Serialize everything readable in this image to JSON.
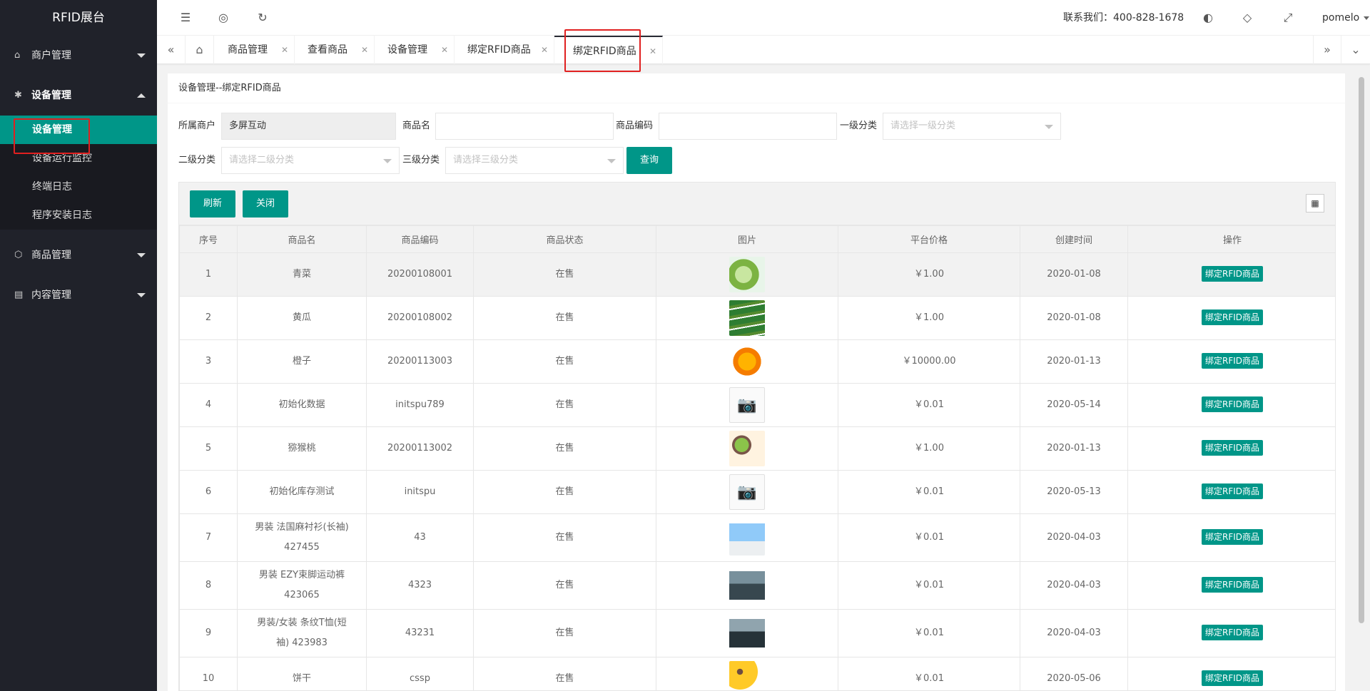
{
  "app": {
    "title": "RFID展台"
  },
  "sidebar": {
    "items": [
      {
        "label": "商户管理",
        "icon": "home-icon"
      },
      {
        "label": "设备管理",
        "icon": "gear-icon"
      },
      {
        "label": "商品管理",
        "icon": "box-icon"
      },
      {
        "label": "内容管理",
        "icon": "document-icon"
      }
    ],
    "device_sub": [
      "设备管理",
      "设备运行监控",
      "终端日志",
      "程序安装日志"
    ]
  },
  "header": {
    "contact": "联系我们：400-828-1678",
    "user": "pomelo"
  },
  "tabs": [
    {
      "label": "商品管理"
    },
    {
      "label": "查看商品"
    },
    {
      "label": "设备管理"
    },
    {
      "label": "绑定RFID商品"
    },
    {
      "label": "绑定RFID商品"
    }
  ],
  "card": {
    "title": "设备管理--绑定RFID商品"
  },
  "filters": {
    "merchant_label": "所属商户",
    "merchant_value": "多屏互动",
    "name_label": "商品名",
    "code_label": "商品编码",
    "cat1_label": "一级分类",
    "cat1_placeholder": "请选择一级分类",
    "cat2_label": "二级分类",
    "cat2_placeholder": "请选择二级分类",
    "cat3_label": "三级分类",
    "cat3_placeholder": "请选择三级分类",
    "query_label": "查询"
  },
  "toolbar": {
    "refresh_label": "刷新",
    "close_label": "关闭"
  },
  "table": {
    "headers": [
      "序号",
      "商品名",
      "商品编码",
      "商品状态",
      "图片",
      "平台价格",
      "创建时间",
      "操作"
    ],
    "action_label": "绑定RFID商品",
    "rows": [
      {
        "no": "1",
        "name": "青菜",
        "code": "20200108001",
        "status": "在售",
        "img": "bok-choy",
        "price": "￥1.00",
        "date": "2020-01-08"
      },
      {
        "no": "2",
        "name": "黄瓜",
        "code": "20200108002",
        "status": "在售",
        "img": "cucumber",
        "price": "￥1.00",
        "date": "2020-01-08"
      },
      {
        "no": "3",
        "name": "橙子",
        "code": "20200113003",
        "status": "在售",
        "img": "orange",
        "price": "￥10000.00",
        "date": "2020-01-13"
      },
      {
        "no": "4",
        "name": "初始化数据",
        "code": "initspu789",
        "status": "在售",
        "img": "placeholder",
        "price": "￥0.01",
        "date": "2020-05-14"
      },
      {
        "no": "5",
        "name": "猕猴桃",
        "code": "20200113002",
        "status": "在售",
        "img": "kiwi",
        "price": "￥1.00",
        "date": "2020-01-13"
      },
      {
        "no": "6",
        "name": "初始化库存测试",
        "code": "initspu",
        "status": "在售",
        "img": "placeholder",
        "price": "￥0.01",
        "date": "2020-05-13"
      },
      {
        "no": "7",
        "name1": "男装 法国麻衬衫(长袖)",
        "name2": "427455",
        "code": "43",
        "status": "在售",
        "img": "shirt",
        "price": "￥0.01",
        "date": "2020-04-03"
      },
      {
        "no": "8",
        "name1": "男装 EZY束脚运动裤",
        "name2": "423065",
        "code": "4323",
        "status": "在售",
        "img": "pants",
        "price": "￥0.01",
        "date": "2020-04-03"
      },
      {
        "no": "9",
        "name1": "男装/女装 条纹T恤(短",
        "name2": "袖) 423983",
        "code": "43231",
        "status": "在售",
        "img": "tshirt",
        "price": "￥0.01",
        "date": "2020-04-03"
      },
      {
        "no": "10",
        "name": "饼干",
        "code": "cssp",
        "status": "在售",
        "img": "biscuit",
        "price": "￥0.01",
        "date": "2020-05-06"
      }
    ]
  },
  "colors": {
    "accent": "#009688",
    "sidebar": "#20222a",
    "highlight": "#e02020"
  }
}
